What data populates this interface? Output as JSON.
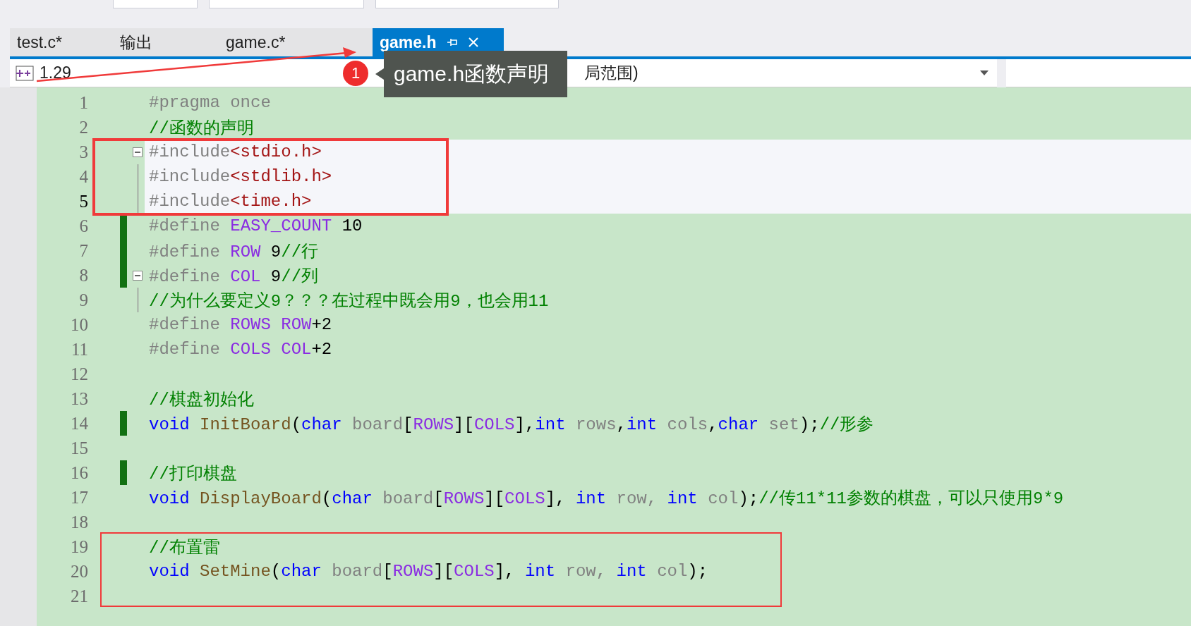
{
  "toolbar": {
    "fields": [
      {
        "kind": "small"
      },
      {
        "kind": "wide"
      },
      {
        "kind": "search"
      }
    ]
  },
  "tabs": [
    {
      "label": "test.c*",
      "selected": false
    },
    {
      "label": "输出",
      "selected": false
    },
    {
      "label": "game.c*",
      "selected": false
    },
    {
      "label": "game.h",
      "selected": true
    }
  ],
  "navigation": {
    "project": "1.29",
    "scope": "局范围)"
  },
  "annotation": {
    "badge": "1",
    "tooltip": "game.h函数声明"
  },
  "lines": [
    {
      "number": "1",
      "current": false,
      "highlighted": false,
      "changed": false,
      "collapsible": false,
      "guide": false,
      "tokens": [
        {
          "kind": "pp",
          "text": "#pragma once"
        }
      ]
    },
    {
      "number": "2",
      "current": false,
      "highlighted": false,
      "changed": false,
      "collapsible": false,
      "guide": false,
      "tokens": [
        {
          "kind": "comment",
          "text": "//函数的声明"
        }
      ]
    },
    {
      "number": "3",
      "current": false,
      "highlighted": true,
      "changed": false,
      "collapsible": true,
      "guide": false,
      "tokens": [
        {
          "kind": "pp",
          "text": "#include"
        },
        {
          "kind": "str",
          "text": "<stdio.h>"
        }
      ]
    },
    {
      "number": "4",
      "current": false,
      "highlighted": true,
      "changed": false,
      "collapsible": false,
      "guide": true,
      "tokens": [
        {
          "kind": "pp",
          "text": "#include"
        },
        {
          "kind": "str",
          "text": "<stdlib.h>"
        }
      ]
    },
    {
      "number": "5",
      "current": true,
      "highlighted": true,
      "changed": false,
      "collapsible": false,
      "guide": true,
      "tokens": [
        {
          "kind": "pp",
          "text": "#include"
        },
        {
          "kind": "str",
          "text": "<time.h>"
        }
      ]
    },
    {
      "number": "6",
      "current": false,
      "highlighted": false,
      "changed": true,
      "collapsible": false,
      "guide": false,
      "tokens": [
        {
          "kind": "pp",
          "text": "#define"
        },
        {
          "kind": "macro",
          "text": " EASY_COUNT"
        },
        {
          "kind": "plain",
          "text": " 10"
        }
      ]
    },
    {
      "number": "7",
      "current": false,
      "highlighted": false,
      "changed": true,
      "collapsible": false,
      "guide": false,
      "tokens": [
        {
          "kind": "pp",
          "text": "#define"
        },
        {
          "kind": "macro",
          "text": " ROW"
        },
        {
          "kind": "plain",
          "text": " 9"
        },
        {
          "kind": "comment",
          "text": "//行"
        }
      ]
    },
    {
      "number": "8",
      "current": false,
      "highlighted": false,
      "changed": true,
      "collapsible": true,
      "guide": false,
      "tokens": [
        {
          "kind": "pp",
          "text": "#define"
        },
        {
          "kind": "macro",
          "text": " COL"
        },
        {
          "kind": "plain",
          "text": " 9"
        },
        {
          "kind": "comment",
          "text": "//列"
        }
      ]
    },
    {
      "number": "9",
      "current": false,
      "highlighted": false,
      "changed": false,
      "collapsible": false,
      "guide": true,
      "tokens": [
        {
          "kind": "comment",
          "text": "//为什么要定义9？？？在过程中既会用9，也会用11"
        }
      ]
    },
    {
      "number": "10",
      "current": false,
      "highlighted": false,
      "changed": false,
      "collapsible": false,
      "guide": false,
      "tokens": [
        {
          "kind": "pp",
          "text": "#define"
        },
        {
          "kind": "macro",
          "text": " ROWS"
        },
        {
          "kind": "macro",
          "text": " ROW"
        },
        {
          "kind": "plain",
          "text": "+2"
        }
      ]
    },
    {
      "number": "11",
      "current": false,
      "highlighted": false,
      "changed": false,
      "collapsible": false,
      "guide": false,
      "tokens": [
        {
          "kind": "pp",
          "text": "#define"
        },
        {
          "kind": "macro",
          "text": " COLS"
        },
        {
          "kind": "macro",
          "text": " COL"
        },
        {
          "kind": "plain",
          "text": "+2"
        }
      ]
    },
    {
      "number": "12",
      "current": false,
      "highlighted": false,
      "changed": false,
      "collapsible": false,
      "guide": false
    },
    {
      "number": "13",
      "current": false,
      "highlighted": false,
      "changed": false,
      "collapsible": false,
      "guide": false,
      "tokens": [
        {
          "kind": "comment",
          "text": "//棋盘初始化"
        }
      ]
    },
    {
      "number": "14",
      "current": false,
      "highlighted": false,
      "changed": true,
      "collapsible": false,
      "guide": false,
      "tokens": [
        {
          "kind": "kw",
          "text": "void"
        },
        {
          "kind": "fn",
          "text": " InitBoard"
        },
        {
          "kind": "plain",
          "text": "("
        },
        {
          "kind": "kw",
          "text": "char"
        },
        {
          "kind": "param",
          "text": " board"
        },
        {
          "kind": "plain",
          "text": "["
        },
        {
          "kind": "macro",
          "text": "ROWS"
        },
        {
          "kind": "plain",
          "text": "]["
        },
        {
          "kind": "macro",
          "text": "COLS"
        },
        {
          "kind": "plain",
          "text": "],"
        },
        {
          "kind": "kw",
          "text": "int"
        },
        {
          "kind": "param",
          "text": " rows"
        },
        {
          "kind": "plain",
          "text": ","
        },
        {
          "kind": "kw",
          "text": "int"
        },
        {
          "kind": "param",
          "text": " cols"
        },
        {
          "kind": "plain",
          "text": ","
        },
        {
          "kind": "kw",
          "text": "char"
        },
        {
          "kind": "param",
          "text": " set"
        },
        {
          "kind": "plain",
          "text": ");"
        },
        {
          "kind": "comment",
          "text": "//形参"
        }
      ]
    },
    {
      "number": "15",
      "current": false,
      "highlighted": false,
      "changed": false,
      "collapsible": false,
      "guide": false
    },
    {
      "number": "16",
      "current": false,
      "highlighted": false,
      "changed": true,
      "collapsible": false,
      "guide": false,
      "tokens": [
        {
          "kind": "comment",
          "text": "//打印棋盘"
        }
      ]
    },
    {
      "number": "17",
      "current": false,
      "highlighted": false,
      "changed": false,
      "collapsible": false,
      "guide": false,
      "tokens": [
        {
          "kind": "kw",
          "text": "void"
        },
        {
          "kind": "fn",
          "text": " DisplayBoard"
        },
        {
          "kind": "plain",
          "text": "("
        },
        {
          "kind": "kw",
          "text": "char"
        },
        {
          "kind": "param",
          "text": " board"
        },
        {
          "kind": "plain",
          "text": "["
        },
        {
          "kind": "macro",
          "text": "ROWS"
        },
        {
          "kind": "plain",
          "text": "]["
        },
        {
          "kind": "macro",
          "text": "COLS"
        },
        {
          "kind": "plain",
          "text": "],"
        },
        {
          "kind": "kw",
          "text": " int"
        },
        {
          "kind": "param",
          "text": " row,"
        },
        {
          "kind": "kw",
          "text": " int"
        },
        {
          "kind": "param",
          "text": " col"
        },
        {
          "kind": "plain",
          "text": ");"
        },
        {
          "kind": "comment",
          "text": "//传11*11参数的棋盘，可以只使用9*9"
        }
      ]
    },
    {
      "number": "18",
      "current": false,
      "highlighted": false,
      "changed": false,
      "collapsible": false,
      "guide": false
    },
    {
      "number": "19",
      "current": false,
      "highlighted": false,
      "changed": false,
      "collapsible": false,
      "guide": false,
      "tokens": [
        {
          "kind": "comment",
          "text": "//布置雷"
        }
      ]
    },
    {
      "number": "20",
      "current": false,
      "highlighted": false,
      "changed": false,
      "collapsible": false,
      "guide": false,
      "tokens": [
        {
          "kind": "kw",
          "text": "void"
        },
        {
          "kind": "fn",
          "text": " SetMine"
        },
        {
          "kind": "plain",
          "text": "("
        },
        {
          "kind": "kw",
          "text": "char"
        },
        {
          "kind": "param",
          "text": " board"
        },
        {
          "kind": "plain",
          "text": "["
        },
        {
          "kind": "macro",
          "text": "ROWS"
        },
        {
          "kind": "plain",
          "text": "]["
        },
        {
          "kind": "macro",
          "text": "COLS"
        },
        {
          "kind": "plain",
          "text": "],"
        },
        {
          "kind": "kw",
          "text": " int"
        },
        {
          "kind": "param",
          "text": " row,"
        },
        {
          "kind": "kw",
          "text": " int"
        },
        {
          "kind": "param",
          "text": " col"
        },
        {
          "kind": "plain",
          "text": ");"
        }
      ]
    },
    {
      "number": "21",
      "current": false,
      "highlighted": false,
      "changed": false,
      "collapsible": false,
      "guide": false
    }
  ]
}
